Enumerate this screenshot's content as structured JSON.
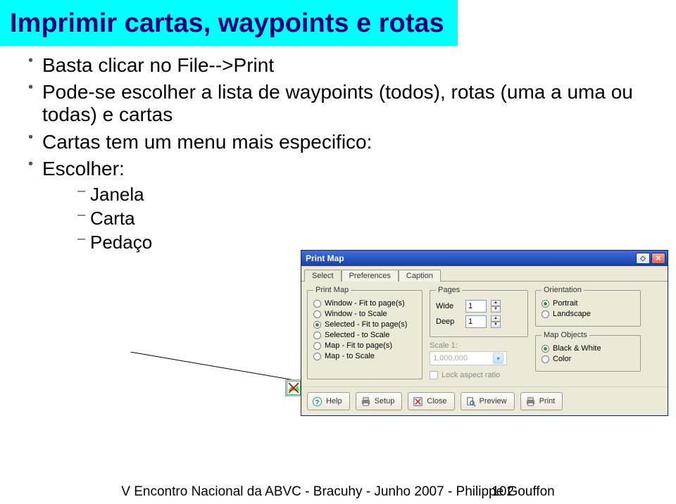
{
  "title": "Imprimir cartas, waypoints e rotas",
  "bullets": [
    "Basta clicar no File-->Print",
    "Pode-se escolher a lista de waypoints (todos), rotas (uma a uma ou todas) e cartas",
    "Cartas tem um menu mais especifico:",
    "Escolher:"
  ],
  "subbullets": [
    "Janela",
    "Carta",
    "Pedaço"
  ],
  "dialog": {
    "title": "Print Map",
    "tabs": [
      "Select",
      "Preferences",
      "Caption"
    ],
    "printmap": {
      "legend": "Print Map",
      "options": [
        "Window - Fit to page(s)",
        "Window - to Scale",
        "Selected - Fit to page(s)",
        "Selected - to Scale",
        "Map - Fit to page(s)",
        "Map - to Scale"
      ],
      "selected_index": 2
    },
    "pages": {
      "legend": "Pages",
      "wide_label": "Wide",
      "wide_value": "1",
      "deep_label": "Deep",
      "deep_value": "1",
      "scale_label": "Scale 1:",
      "scale_value": "1,000,000",
      "lock_label": "Lock aspect ratio"
    },
    "orientation": {
      "legend": "Orientation",
      "options": [
        "Portrait",
        "Landscape"
      ],
      "selected_index": 0
    },
    "mapobjects": {
      "legend": "Map Objects",
      "options": [
        "Black & White",
        "Color"
      ],
      "selected_index": 0
    },
    "buttons": {
      "help": "Help",
      "setup": "Setup",
      "close": "Close",
      "preview": "Preview",
      "print": "Print"
    }
  },
  "footer": "V Encontro Nacional da ABVC - Bracuhy - Junho 2007 - Philippe Gouffon",
  "page_number": "102"
}
